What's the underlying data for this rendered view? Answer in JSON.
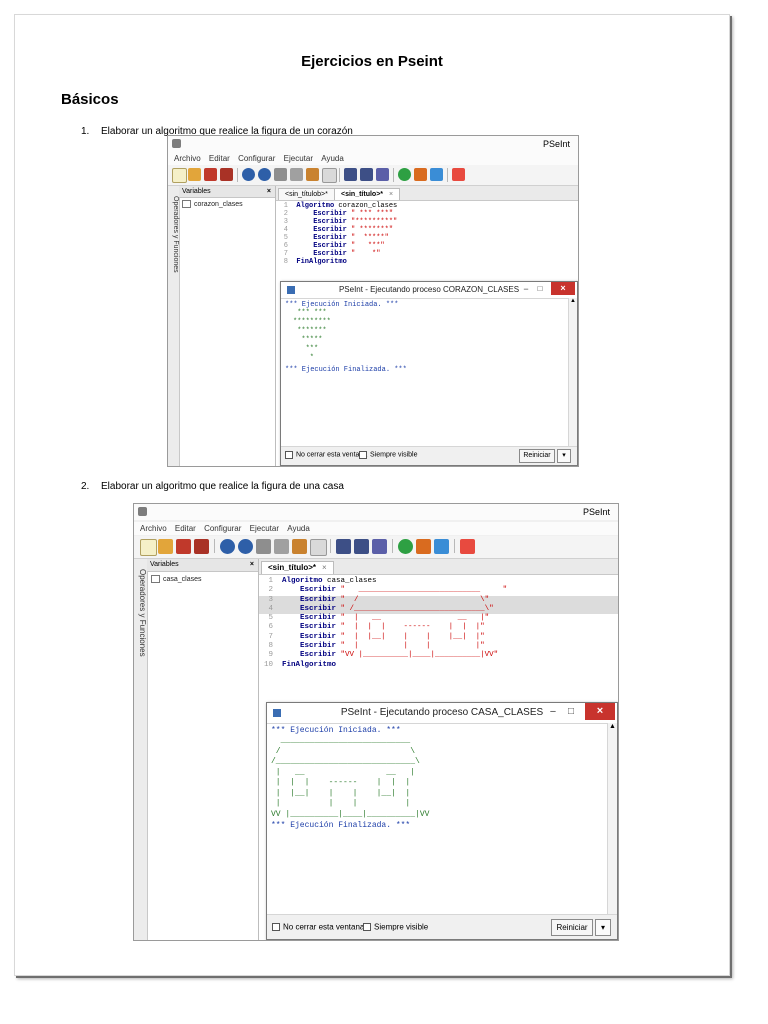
{
  "document": {
    "title": "Ejercicios en Pseint",
    "section": "Básicos",
    "items": [
      {
        "num": "1.",
        "text": "Elaborar un algoritmo que realice la figura de un corazón"
      },
      {
        "num": "2.",
        "text": "Elaborar un algoritmo que realice la figura de una casa"
      }
    ]
  },
  "colors": {
    "keyword": "#000080",
    "string": "#cc0000",
    "console_text": "#1d3ea8",
    "output_art": "#2a7a2a",
    "close_button": "#c8332d"
  },
  "toolbar_icons": [
    "new-file-icon",
    "open-folder-icon",
    "save-icon",
    "save-as-icon",
    "undo-icon",
    "redo-icon",
    "cut-icon",
    "copy-icon",
    "paste-icon",
    "find-icon",
    "indent-icon",
    "format-icon",
    "run-icon",
    "step-icon",
    "diagram-icon",
    "help-icon"
  ],
  "screenshot1": {
    "app_title": "PSeInt",
    "menu": [
      "Archivo",
      "Editar",
      "Configurar",
      "Ejecutar",
      "Ayuda"
    ],
    "sidebar": {
      "vertical_label": "Operadores y Funciones",
      "panel_title": "Variables",
      "close": "×",
      "item": "corazon_clases"
    },
    "tabs": [
      {
        "label": "<sin_títulob>*"
      },
      {
        "label": "<sin_título>*",
        "close": "×"
      }
    ],
    "code": [
      {
        "n": "1",
        "kw": "Algoritmo",
        "rest": " corazon_clases",
        "str": ""
      },
      {
        "n": "2",
        "kw": "    Escribir",
        "rest": " ",
        "str": "\" *** ***\""
      },
      {
        "n": "3",
        "kw": "    Escribir",
        "rest": " ",
        "str": "\"*********\""
      },
      {
        "n": "4",
        "kw": "    Escribir",
        "rest": " ",
        "str": "\" *******\""
      },
      {
        "n": "5",
        "kw": "    Escribir",
        "rest": " ",
        "str": "\"  *****\""
      },
      {
        "n": "6",
        "kw": "    Escribir",
        "rest": " ",
        "str": "\"   ***\""
      },
      {
        "n": "7",
        "kw": "    Escribir",
        "rest": " ",
        "str": "\"    *\""
      },
      {
        "n": "8",
        "kw": "FinAlgoritmo",
        "rest": "",
        "str": ""
      }
    ],
    "console": {
      "title": "PSeInt - Ejecutando proceso CORAZON_CLASES",
      "minimize": "−",
      "maximize": "□",
      "close": "×",
      "start": "*** Ejecución Iniciada. ***",
      "art": " *** ***\n*********\n *******\n  *****\n   ***\n    *",
      "end": "*** Ejecución Finalizada. ***",
      "no_close_label": "No cerrar esta ventana",
      "always_visible_label": "Siempre visible",
      "restart_label": "Reiniciar",
      "scroll_up": "▲",
      "dropdown": "▾"
    }
  },
  "screenshot2": {
    "app_title": "PSeInt",
    "menu": [
      "Archivo",
      "Editar",
      "Configurar",
      "Ejecutar",
      "Ayuda"
    ],
    "sidebar": {
      "vertical_label": "Operadores y Funciones",
      "panel_title": "Variables",
      "close": "×",
      "item": "casa_clases"
    },
    "tabs": [
      {
        "label": "<sin_título>*",
        "close": "×"
      }
    ],
    "code": [
      {
        "n": "1",
        "kw": "Algoritmo",
        "rest": " casa_clases",
        "str": ""
      },
      {
        "n": "2",
        "kw": "    Escribir",
        "rest": " ",
        "str": "\"   ___________________________     \""
      },
      {
        "n": "3",
        "kw": "    Escribir",
        "rest": " ",
        "str": "\"  /                           \\\""
      },
      {
        "n": "4",
        "kw": "    Escribir",
        "rest": " ",
        "str": "\" /_____________________________\\\""
      },
      {
        "n": "5",
        "kw": "    Escribir",
        "rest": " ",
        "str": "\"  |   __                 __   |\""
      },
      {
        "n": "6",
        "kw": "    Escribir",
        "rest": " ",
        "str": "\"  |  |  |    ------    |  |  |\""
      },
      {
        "n": "7",
        "kw": "    Escribir",
        "rest": " ",
        "str": "\"  |  |__|    |    |    |__|  |\""
      },
      {
        "n": "8",
        "kw": "    Escribir",
        "rest": " ",
        "str": "\"  |          |    |          |\""
      },
      {
        "n": "9",
        "kw": "    Escribir",
        "rest": " ",
        "str": "\"VV |__________|____|__________|VV\""
      },
      {
        "n": "10",
        "kw": "FinAlgoritmo",
        "rest": "",
        "str": ""
      }
    ],
    "console": {
      "title": "PSeInt - Ejecutando proceso CASA_CLASES",
      "minimize": "−",
      "maximize": "□",
      "close": "×",
      "start": "*** Ejecución Iniciada. ***",
      "art": "  ___________________________\n /                           \\\n/_____________________________\\\n |   __                 __   |\n |  |  |    ------    |  |  |\n |  |__|    |    |    |__|  |\n |          |    |          |\nVV |__________|____|__________|VV",
      "end": "*** Ejecución Finalizada. ***",
      "no_close_label": "No cerrar esta ventana",
      "always_visible_label": "Siempre visible",
      "restart_label": "Reiniciar",
      "scroll_up": "▲",
      "dropdown": "▾"
    }
  }
}
